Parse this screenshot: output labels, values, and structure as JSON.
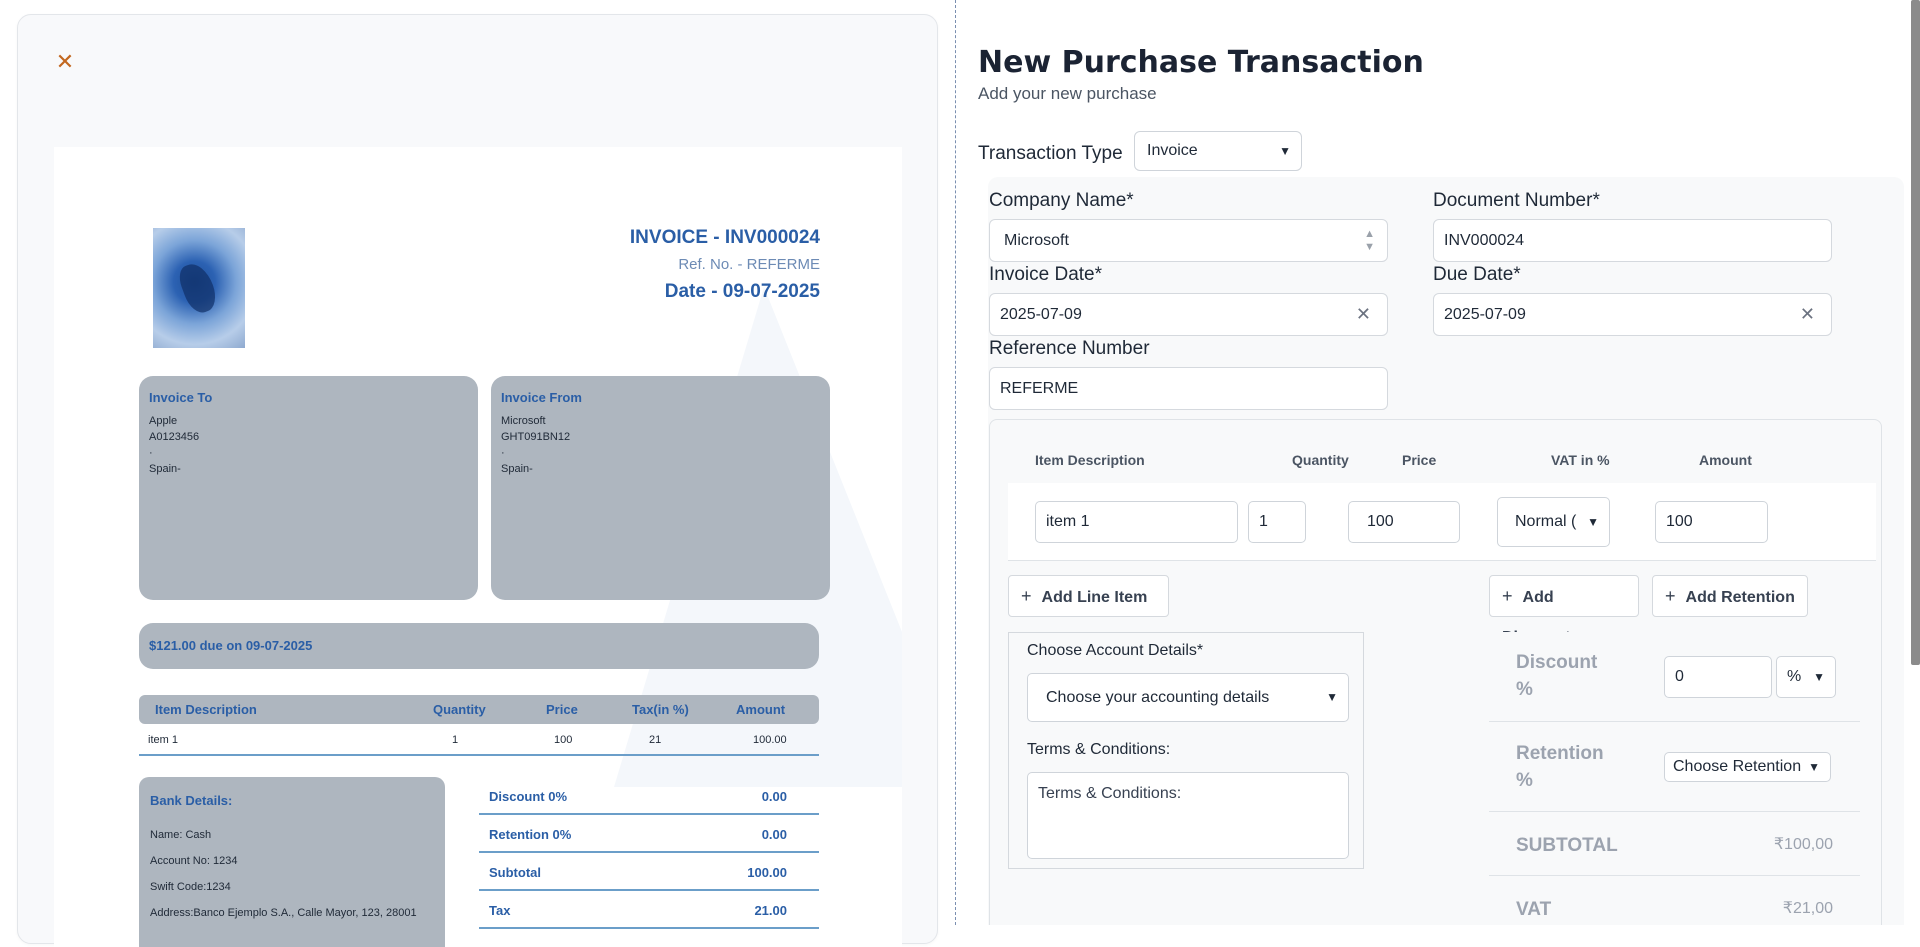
{
  "preview": {
    "close_icon": "✕",
    "invoice_title": "INVOICE - INV000024",
    "ref_line": "Ref. No. - REFERME",
    "date_line": "Date - 09-07-2025",
    "invoice_to": {
      "heading": "Invoice To",
      "lines": [
        "Apple",
        "A0123456",
        "·",
        "Spain-"
      ]
    },
    "invoice_from": {
      "heading": "Invoice From",
      "lines": [
        "Microsoft",
        "GHT091BN12",
        "·",
        "Spain-"
      ]
    },
    "due_text": "$121.00 due on 09-07-2025",
    "table": {
      "headers": [
        "Item Description",
        "Quantity",
        "Price",
        "Tax(in %)",
        "Amount"
      ],
      "rows": [
        [
          "item 1",
          "1",
          "100",
          "21",
          "100.00"
        ]
      ]
    },
    "bank": {
      "heading": "Bank Details:",
      "lines": [
        "Name: Cash",
        "Account No: 1234",
        "Swift Code:1234",
        "Address:Banco Ejemplo S.A., Calle Mayor, 123, 28001"
      ]
    },
    "totals": [
      {
        "label": "Discount 0%",
        "value": "0.00"
      },
      {
        "label": "Retention 0%",
        "value": "0.00"
      },
      {
        "label": "Subtotal",
        "value": "100.00"
      },
      {
        "label": "Tax",
        "value": "21.00"
      }
    ]
  },
  "form": {
    "title": "New Purchase Transaction",
    "subtitle": "Add your new purchase",
    "transaction_type_label": "Transaction Type",
    "transaction_type_value": "Invoice",
    "company_name_label": "Company Name*",
    "company_name_value": "Microsoft",
    "document_number_label": "Document Number*",
    "document_number_value": "INV000024",
    "invoice_date_label": "Invoice Date*",
    "invoice_date_value": "2025-07-09",
    "due_date_label": "Due Date*",
    "due_date_value": "2025-07-09",
    "reference_label": "Reference Number",
    "reference_value": "REFERME",
    "items_headers": {
      "description": "Item Description",
      "quantity": "Quantity",
      "price": "Price",
      "vat": "VAT in %",
      "amount": "Amount"
    },
    "item": {
      "description": "item 1",
      "quantity": "1",
      "price": "100",
      "vat": "Normal (",
      "amount": "100"
    },
    "add_line_item": "Add Line Item",
    "add_discount": "Add Discount",
    "add_retention": "Add Retention",
    "account_label": "Choose Account Details*",
    "account_placeholder": "Choose your accounting details",
    "terms_label": "Terms & Conditions:",
    "terms_placeholder": "Terms & Conditions:",
    "discount_label": "Discount %",
    "discount_value": "0",
    "discount_unit": "%",
    "retention_label": "Retention %",
    "retention_select": "Choose Retention",
    "subtotal_label": "SUBTOTAL",
    "subtotal_value": "₹100,00",
    "vat_label": "VAT",
    "vat_value": "₹21,00"
  },
  "colors": {
    "accent_blue": "#2a5ea6",
    "card_gray": "#aeb6bf",
    "close_orange": "#c2671f"
  },
  "icons": {
    "close": "close-icon",
    "plus": "plus-icon",
    "chevron": "chevron-down-icon",
    "clear": "clear-icon"
  }
}
